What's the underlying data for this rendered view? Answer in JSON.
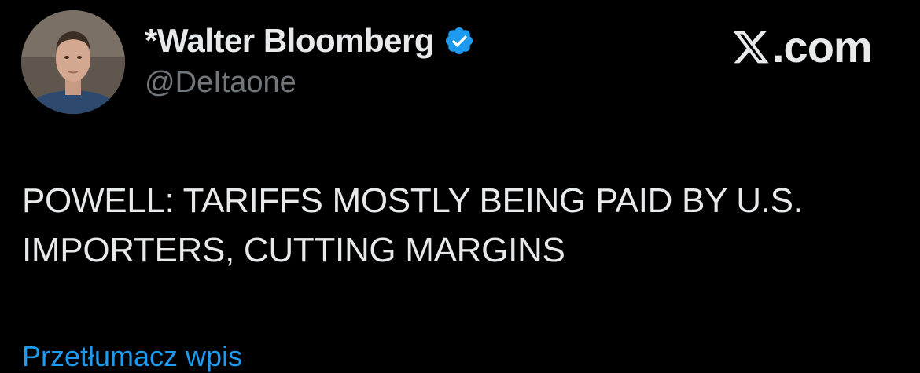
{
  "author": {
    "display_name": "*Walter Bloomberg",
    "handle": "@DeItaone",
    "verified": true,
    "avatar_icon": "profile-photo"
  },
  "brand": {
    "logo_icon": "x-logo",
    "text": ".com"
  },
  "tweet": {
    "lines": [
      "POWELL: TARIFFS MOSTLY BEING PAID BY U.S.",
      "IMPORTERS, CUTTING MARGINS"
    ]
  },
  "translate": {
    "label": "Przetłumacz wpis"
  },
  "colors": {
    "background": "#000000",
    "text_primary": "#e7e9ea",
    "text_secondary": "#71767b",
    "link": "#1d9bf0",
    "verified_badge": "#1d9bf0"
  }
}
